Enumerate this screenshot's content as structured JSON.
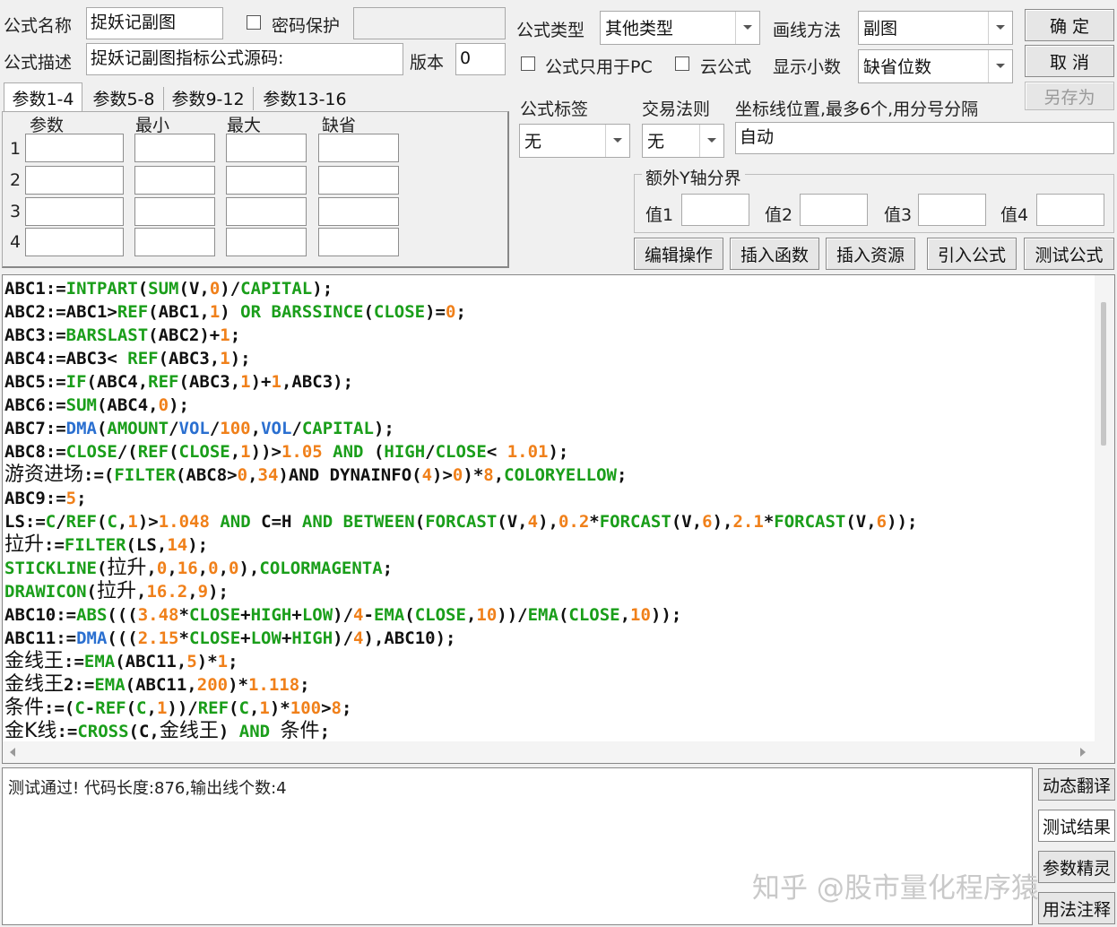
{
  "formula": {
    "name_label": "公式名称",
    "name_value": "捉妖记副图",
    "password_label": "密码保护",
    "desc_label": "公式描述",
    "desc_value": "捉妖记副图指标公式源码:",
    "version_label": "版本",
    "version_value": "0",
    "type_label": "公式类型",
    "type_value": "其他类型",
    "draw_label": "画线方法",
    "draw_value": "副图",
    "pc_only_label": "公式只用于PC",
    "cloud_label": "云公式",
    "decimal_label": "显示小数",
    "decimal_value": "缺省位数"
  },
  "buttons": {
    "ok": "确 定",
    "cancel": "取 消",
    "save_as": "另存为",
    "edit_ops": "编辑操作",
    "insert_func": "插入函数",
    "insert_res": "插入资源",
    "import_formula": "引入公式",
    "test_formula": "测试公式",
    "dyn_translate": "动态翻译",
    "test_result": "测试结果",
    "param_wizard": "参数精灵",
    "usage_notes": "用法注释"
  },
  "tabs": [
    "参数1-4",
    "参数5-8",
    "参数9-12",
    "参数13-16"
  ],
  "params": {
    "headers": [
      "参数",
      "最小",
      "最大",
      "缺省"
    ],
    "rows": [
      "1",
      "2",
      "3",
      "4"
    ]
  },
  "tags": {
    "tag_label": "公式标签",
    "tag_value": "无",
    "rule_label": "交易法则",
    "rule_value": "无",
    "coord_label": "坐标线位置,最多6个,用分号分隔",
    "coord_value": "自动"
  },
  "yaxis": {
    "title": "额外Y轴分界",
    "labels": [
      "值1",
      "值2",
      "值3",
      "值4"
    ]
  },
  "output": {
    "message": "测试通过! 代码长度:876,输出线个数:4"
  },
  "watermark": "知乎 @股市量化程序猿",
  "code_lines": [
    [
      [
        "ABC1:=",
        ""
      ],
      [
        "INTPART",
        "g"
      ],
      [
        "(",
        ""
      ],
      [
        "SUM",
        "g"
      ],
      [
        "(V,",
        ""
      ],
      [
        "0",
        "o"
      ],
      [
        ")/",
        ""
      ],
      [
        "CAPITAL",
        "g"
      ],
      [
        ");",
        ""
      ]
    ],
    [
      [
        "ABC2:=ABC1>",
        ""
      ],
      [
        "REF",
        "g"
      ],
      [
        "(ABC1,",
        ""
      ],
      [
        "1",
        "o"
      ],
      [
        ") ",
        ""
      ],
      [
        "OR",
        "g"
      ],
      [
        " ",
        ""
      ],
      [
        "BARSSINCE",
        "g"
      ],
      [
        "(",
        ""
      ],
      [
        "CLOSE",
        "g"
      ],
      [
        ")=",
        ""
      ],
      [
        "0",
        "o"
      ],
      [
        ";",
        ""
      ]
    ],
    [
      [
        "ABC3:=",
        ""
      ],
      [
        "BARSLAST",
        "g"
      ],
      [
        "(ABC2)+",
        ""
      ],
      [
        "1",
        "o"
      ],
      [
        ";",
        ""
      ]
    ],
    [
      [
        "ABC4:=ABC3< ",
        ""
      ],
      [
        "REF",
        "g"
      ],
      [
        "(ABC3,",
        ""
      ],
      [
        "1",
        "o"
      ],
      [
        ");",
        ""
      ]
    ],
    [
      [
        "ABC5:=",
        ""
      ],
      [
        "IF",
        "g"
      ],
      [
        "(ABC4,",
        ""
      ],
      [
        "REF",
        "g"
      ],
      [
        "(ABC3,",
        ""
      ],
      [
        "1",
        "o"
      ],
      [
        ")+",
        ""
      ],
      [
        "1",
        "o"
      ],
      [
        ",ABC3);",
        ""
      ]
    ],
    [
      [
        "ABC6:=",
        ""
      ],
      [
        "SUM",
        "g"
      ],
      [
        "(ABC4,",
        ""
      ],
      [
        "0",
        "o"
      ],
      [
        ");",
        ""
      ]
    ],
    [
      [
        "ABC7:=",
        ""
      ],
      [
        "DMA",
        "b"
      ],
      [
        "(",
        ""
      ],
      [
        "AMOUNT",
        "g"
      ],
      [
        "/",
        ""
      ],
      [
        "VOL",
        "b"
      ],
      [
        "/",
        ""
      ],
      [
        "100",
        "o"
      ],
      [
        ",",
        ""
      ],
      [
        "VOL",
        "b"
      ],
      [
        "/",
        ""
      ],
      [
        "CAPITAL",
        "g"
      ],
      [
        ");",
        ""
      ]
    ],
    [
      [
        "ABC8:=",
        ""
      ],
      [
        "CLOSE",
        "g"
      ],
      [
        "/(",
        ""
      ],
      [
        "REF",
        "g"
      ],
      [
        "(",
        ""
      ],
      [
        "CLOSE",
        "g"
      ],
      [
        ",",
        ""
      ],
      [
        "1",
        "o"
      ],
      [
        "))>",
        ""
      ],
      [
        "1.05",
        "o"
      ],
      [
        " ",
        ""
      ],
      [
        "AND",
        "g"
      ],
      [
        " (",
        ""
      ],
      [
        "HIGH",
        "g"
      ],
      [
        "/",
        ""
      ],
      [
        "CLOSE",
        "g"
      ],
      [
        "< ",
        ""
      ],
      [
        "1.01",
        "o"
      ],
      [
        ");",
        ""
      ]
    ],
    [
      [
        "游资进场",
        "cn"
      ],
      [
        ":=(",
        ""
      ],
      [
        "FILTER",
        "g"
      ],
      [
        "(ABC8>",
        ""
      ],
      [
        "0",
        "o"
      ],
      [
        ",",
        ""
      ],
      [
        "34",
        "o"
      ],
      [
        ")AND DYNAINFO(",
        ""
      ],
      [
        "4",
        "o"
      ],
      [
        ")>",
        ""
      ],
      [
        "0",
        "o"
      ],
      [
        ")*",
        ""
      ],
      [
        "8",
        "o"
      ],
      [
        ",",
        ""
      ],
      [
        "COLORYELLOW",
        "g"
      ],
      [
        ";",
        ""
      ]
    ],
    [
      [
        "ABC9:=",
        ""
      ],
      [
        "5",
        "o"
      ],
      [
        ";",
        ""
      ]
    ],
    [
      [
        "LS:=",
        ""
      ],
      [
        "C",
        "g"
      ],
      [
        "/",
        ""
      ],
      [
        "REF",
        "g"
      ],
      [
        "(",
        ""
      ],
      [
        "C",
        "g"
      ],
      [
        ",",
        ""
      ],
      [
        "1",
        "o"
      ],
      [
        ")>",
        ""
      ],
      [
        "1.048",
        "o"
      ],
      [
        " ",
        ""
      ],
      [
        "AND",
        "g"
      ],
      [
        " C=H ",
        ""
      ],
      [
        "AND",
        "g"
      ],
      [
        " ",
        ""
      ],
      [
        "BETWEEN",
        "g"
      ],
      [
        "(",
        ""
      ],
      [
        "FORCAST",
        "g"
      ],
      [
        "(V,",
        ""
      ],
      [
        "4",
        "o"
      ],
      [
        "),",
        ""
      ],
      [
        "0.2",
        "o"
      ],
      [
        "*",
        ""
      ],
      [
        "FORCAST",
        "g"
      ],
      [
        "(V,",
        ""
      ],
      [
        "6",
        "o"
      ],
      [
        "),",
        ""
      ],
      [
        "2.1",
        "o"
      ],
      [
        "*",
        ""
      ],
      [
        "FORCAST",
        "g"
      ],
      [
        "(V,",
        ""
      ],
      [
        "6",
        "o"
      ],
      [
        "));",
        ""
      ]
    ],
    [
      [
        "拉升",
        "cn"
      ],
      [
        ":=",
        ""
      ],
      [
        "FILTER",
        "g"
      ],
      [
        "(LS,",
        ""
      ],
      [
        "14",
        "o"
      ],
      [
        ");",
        ""
      ]
    ],
    [
      [
        "STICKLINE",
        "g"
      ],
      [
        "(",
        ""
      ],
      [
        "拉升",
        "cn"
      ],
      [
        ",",
        ""
      ],
      [
        "0",
        "o"
      ],
      [
        ",",
        ""
      ],
      [
        "16",
        "o"
      ],
      [
        ",",
        ""
      ],
      [
        "0",
        "o"
      ],
      [
        ",",
        ""
      ],
      [
        "0",
        "o"
      ],
      [
        "),",
        ""
      ],
      [
        "COLORMAGENTA",
        "g"
      ],
      [
        ";",
        ""
      ]
    ],
    [
      [
        "DRAWICON",
        "g"
      ],
      [
        "(",
        ""
      ],
      [
        "拉升",
        "cn"
      ],
      [
        ",",
        ""
      ],
      [
        "16.2",
        "o"
      ],
      [
        ",",
        ""
      ],
      [
        "9",
        "o"
      ],
      [
        ");",
        ""
      ]
    ],
    [
      [
        "ABC10:=",
        ""
      ],
      [
        "ABS",
        "g"
      ],
      [
        "(((",
        ""
      ],
      [
        "3.48",
        "o"
      ],
      [
        "*",
        ""
      ],
      [
        "CLOSE",
        "g"
      ],
      [
        "+",
        ""
      ],
      [
        "HIGH",
        "g"
      ],
      [
        "+",
        ""
      ],
      [
        "LOW",
        "g"
      ],
      [
        ")/",
        ""
      ],
      [
        "4",
        "o"
      ],
      [
        "-",
        ""
      ],
      [
        "EMA",
        "g"
      ],
      [
        "(",
        ""
      ],
      [
        "CLOSE",
        "g"
      ],
      [
        ",",
        ""
      ],
      [
        "10",
        "o"
      ],
      [
        "))/",
        ""
      ],
      [
        "EMA",
        "g"
      ],
      [
        "(",
        ""
      ],
      [
        "CLOSE",
        "g"
      ],
      [
        ",",
        ""
      ],
      [
        "10",
        "o"
      ],
      [
        "));",
        ""
      ]
    ],
    [
      [
        "ABC11:=",
        ""
      ],
      [
        "DMA",
        "b"
      ],
      [
        "(((",
        ""
      ],
      [
        "2.15",
        "o"
      ],
      [
        "*",
        ""
      ],
      [
        "CLOSE",
        "g"
      ],
      [
        "+",
        ""
      ],
      [
        "LOW",
        "g"
      ],
      [
        "+",
        ""
      ],
      [
        "HIGH",
        "g"
      ],
      [
        ")/",
        ""
      ],
      [
        "4",
        "o"
      ],
      [
        "),ABC10);",
        ""
      ]
    ],
    [
      [
        "金线王",
        "cn"
      ],
      [
        ":=",
        ""
      ],
      [
        "EMA",
        "g"
      ],
      [
        "(ABC11,",
        ""
      ],
      [
        "5",
        "o"
      ],
      [
        ")*",
        ""
      ],
      [
        "1",
        "o"
      ],
      [
        ";",
        ""
      ]
    ],
    [
      [
        "金线王",
        "cn"
      ],
      [
        "2:=",
        ""
      ],
      [
        "EMA",
        "g"
      ],
      [
        "(ABC11,",
        ""
      ],
      [
        "200",
        "o"
      ],
      [
        ")*",
        ""
      ],
      [
        "1.118",
        "o"
      ],
      [
        ";",
        ""
      ]
    ],
    [
      [
        "条件",
        "cn"
      ],
      [
        ":=(",
        ""
      ],
      [
        "C",
        "g"
      ],
      [
        "-",
        ""
      ],
      [
        "REF",
        "g"
      ],
      [
        "(",
        ""
      ],
      [
        "C",
        "g"
      ],
      [
        ",",
        ""
      ],
      [
        "1",
        "o"
      ],
      [
        "))/",
        ""
      ],
      [
        "REF",
        "g"
      ],
      [
        "(",
        ""
      ],
      [
        "C",
        "g"
      ],
      [
        ",",
        ""
      ],
      [
        "1",
        "o"
      ],
      [
        ")*",
        ""
      ],
      [
        "100",
        "o"
      ],
      [
        ">",
        ""
      ],
      [
        "8",
        "o"
      ],
      [
        ";",
        ""
      ]
    ],
    [
      [
        "金K线",
        "cn"
      ],
      [
        ":=",
        ""
      ],
      [
        "CROSS",
        "g"
      ],
      [
        "(C,",
        ""
      ],
      [
        "金线王",
        "cn"
      ],
      [
        ") ",
        ""
      ],
      [
        "AND",
        "g"
      ],
      [
        " ",
        ""
      ],
      [
        "条件",
        "cn"
      ],
      [
        ";",
        ""
      ]
    ]
  ]
}
